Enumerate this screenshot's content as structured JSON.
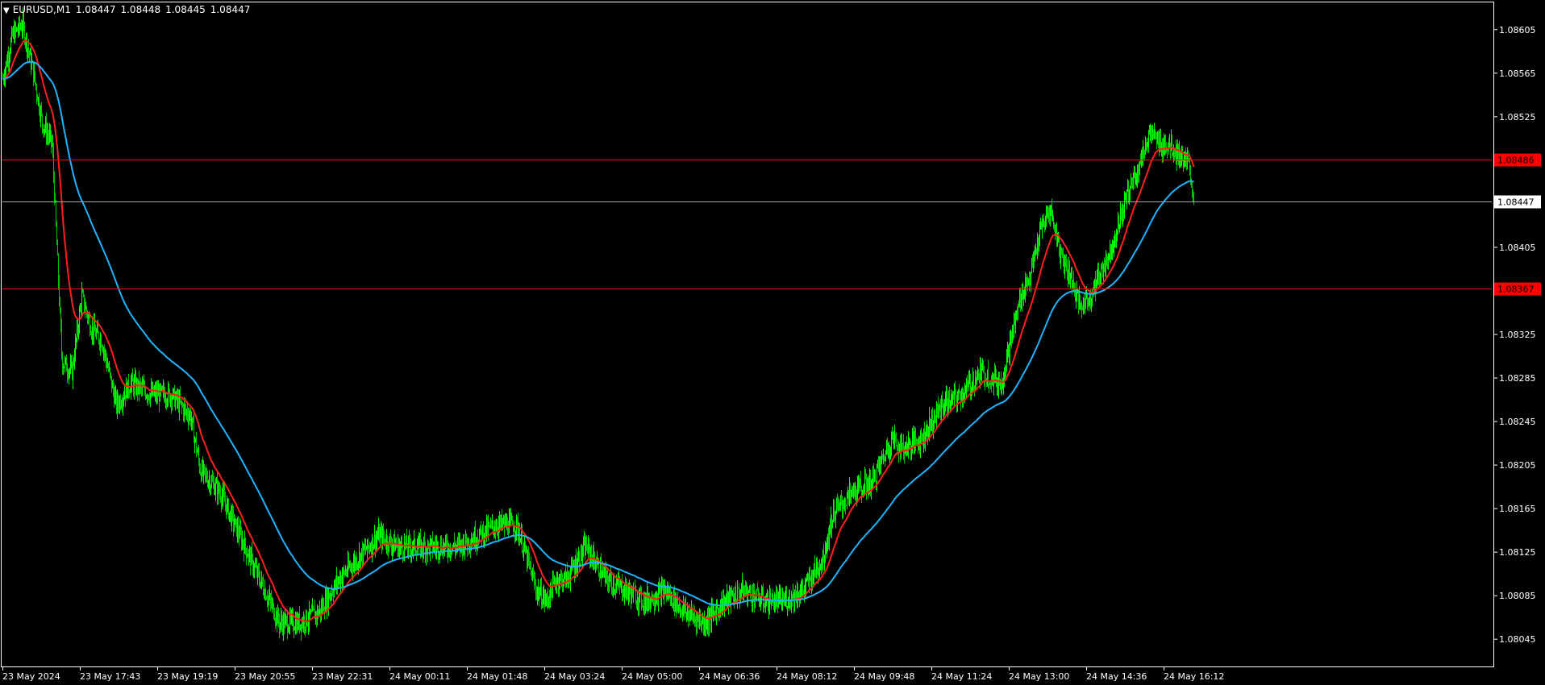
{
  "window": {
    "symbol_label": "EURUSD,M1",
    "ohlc": [
      "1.08447",
      "1.08448",
      "1.08445",
      "1.08447"
    ],
    "menu_icon": "triangle-down-icon"
  },
  "colors": {
    "background": "#000000",
    "frame": "#ffffff",
    "candle_up": "#00ff00",
    "candle_down": "#00c000",
    "ma_fast": "#ff1f1f",
    "ma_slow": "#1fb4ff",
    "level_line": "#ff0000",
    "bid_line": "#a0a8b8",
    "axis_text": "#ffffff"
  },
  "chart_data": {
    "type": "candlestick",
    "symbol": "EURUSD",
    "timeframe": "M1",
    "ylim": [
      1.0802,
      1.0863
    ],
    "y_ticks": [
      "1.08605",
      "1.08565",
      "1.08525",
      "1.08405",
      "1.08325",
      "1.08285",
      "1.08245",
      "1.08205",
      "1.08165",
      "1.08125",
      "1.08085",
      "1.08045"
    ],
    "x_ticks": [
      "23 May 2024",
      "23 May 17:43",
      "23 May 19:19",
      "23 May 20:55",
      "23 May 22:31",
      "24 May 00:11",
      "24 May 01:48",
      "24 May 03:24",
      "24 May 05:00",
      "24 May 06:36",
      "24 May 08:12",
      "24 May 09:48",
      "24 May 11:24",
      "24 May 13:00",
      "24 May 14:36",
      "24 May 16:12"
    ],
    "price_points": [
      [
        0,
        1.0856
      ],
      [
        2,
        1.086
      ],
      [
        4,
        1.0861
      ],
      [
        6,
        1.0857
      ],
      [
        8,
        1.0852
      ],
      [
        10,
        1.085
      ],
      [
        11,
        1.084
      ],
      [
        12,
        1.083
      ],
      [
        14,
        1.0829
      ],
      [
        16,
        1.0836
      ],
      [
        18,
        1.0833
      ],
      [
        20,
        1.0832
      ],
      [
        23,
        1.0826
      ],
      [
        26,
        1.0828
      ],
      [
        30,
        1.0827
      ],
      [
        34,
        1.0827
      ],
      [
        38,
        1.0825
      ],
      [
        40,
        1.082
      ],
      [
        44,
        1.0818
      ],
      [
        48,
        1.0814
      ],
      [
        52,
        1.081
      ],
      [
        56,
        1.0806
      ],
      [
        60,
        1.0806
      ],
      [
        64,
        1.0807
      ],
      [
        68,
        1.081
      ],
      [
        72,
        1.0812
      ],
      [
        76,
        1.0814
      ],
      [
        80,
        1.0813
      ],
      [
        84,
        1.0813
      ],
      [
        88,
        1.0813
      ],
      [
        92,
        1.0813
      ],
      [
        96,
        1.0814
      ],
      [
        100,
        1.0815
      ],
      [
        104,
        1.0815
      ],
      [
        106,
        1.0812
      ],
      [
        108,
        1.0809
      ],
      [
        110,
        1.0808
      ],
      [
        112,
        1.081
      ],
      [
        114,
        1.081
      ],
      [
        118,
        1.0813
      ],
      [
        122,
        1.081
      ],
      [
        126,
        1.0809
      ],
      [
        130,
        1.0808
      ],
      [
        134,
        1.0809
      ],
      [
        138,
        1.0807
      ],
      [
        142,
        1.0806
      ],
      [
        146,
        1.0808
      ],
      [
        150,
        1.0809
      ],
      [
        154,
        1.0808
      ],
      [
        158,
        1.0808
      ],
      [
        162,
        1.0809
      ],
      [
        166,
        1.0812
      ],
      [
        168,
        1.0816
      ],
      [
        172,
        1.0818
      ],
      [
        176,
        1.0819
      ],
      [
        178,
        1.0821
      ],
      [
        180,
        1.0823
      ],
      [
        182,
        1.0822
      ],
      [
        186,
        1.0823
      ],
      [
        190,
        1.0826
      ],
      [
        194,
        1.0827
      ],
      [
        198,
        1.0829
      ],
      [
        202,
        1.0828
      ],
      [
        204,
        1.0832
      ],
      [
        206,
        1.0836
      ],
      [
        208,
        1.0838
      ],
      [
        210,
        1.0842
      ],
      [
        212,
        1.0844
      ],
      [
        214,
        1.084
      ],
      [
        216,
        1.0838
      ],
      [
        218,
        1.0835
      ],
      [
        220,
        1.0836
      ],
      [
        222,
        1.0838
      ],
      [
        224,
        1.084
      ],
      [
        226,
        1.0843
      ],
      [
        228,
        1.0846
      ],
      [
        230,
        1.0848
      ],
      [
        232,
        1.0851
      ],
      [
        234,
        1.085
      ],
      [
        236,
        1.085
      ],
      [
        238,
        1.0849
      ],
      [
        240,
        1.0848
      ],
      [
        241,
        1.0845
      ]
    ],
    "horizontal_levels": [
      {
        "price": "1.08486",
        "style": "level"
      },
      {
        "price": "1.08367",
        "style": "level"
      },
      {
        "price": "1.08447",
        "style": "bid"
      }
    ],
    "moving_averages": [
      "fast",
      "slow"
    ]
  }
}
